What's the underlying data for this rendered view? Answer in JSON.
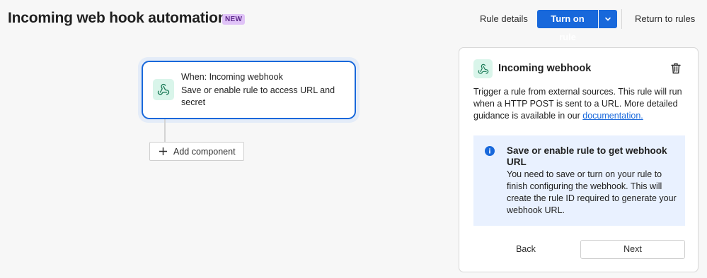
{
  "header": {
    "title": "Incoming web hook automation",
    "badge": "NEW",
    "rule_details_label": "Rule details",
    "turn_on_label": "Turn on rule",
    "return_label": "Return to rules"
  },
  "canvas": {
    "trigger": {
      "title": "When: Incoming webhook",
      "description": "Save or enable rule to access URL and secret",
      "icon": "webhook-icon"
    },
    "add_component_label": "Add component"
  },
  "panel": {
    "title": "Incoming webhook",
    "icon": "webhook-icon",
    "description": "Trigger a rule from external sources. This rule will run when a HTTP POST is sent to a URL. More detailed guidance is available in our",
    "link_text": "documentation.",
    "info": {
      "title": "Save or enable rule to get webhook URL",
      "body": "You need to save or turn on your rule to finish configuring the webhook. This will create the rule ID required to generate your webhook URL."
    },
    "back_label": "Back",
    "next_label": "Next"
  },
  "colors": {
    "primary": "#1868db",
    "badge_bg": "#e0c3f7",
    "icon_bg": "#d9f5ea",
    "info_bg": "#e9f1ff"
  }
}
